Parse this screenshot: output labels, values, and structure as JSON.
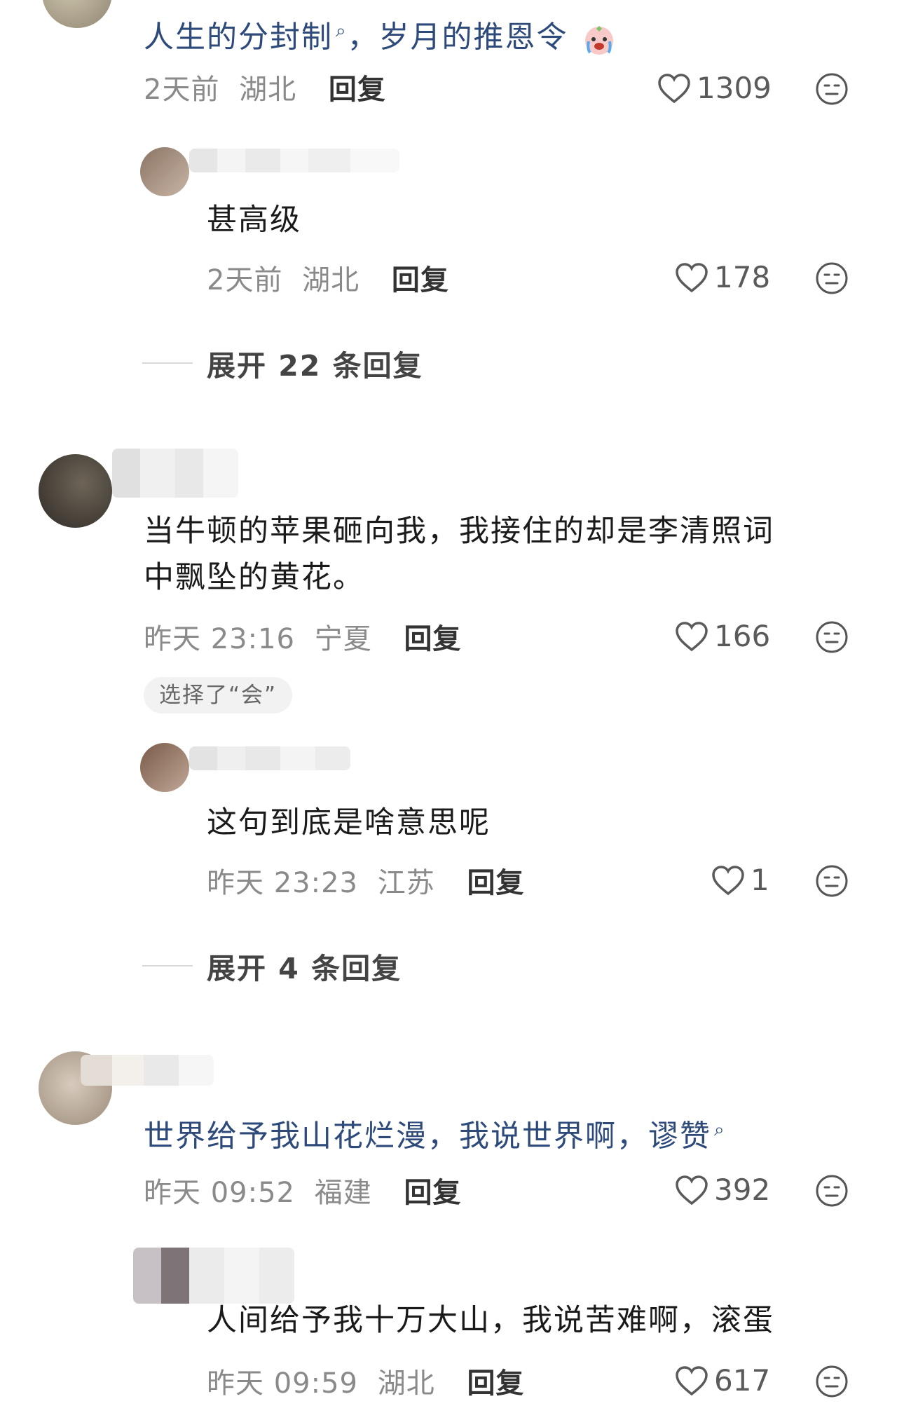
{
  "comments": [
    {
      "text": "人生的分封制",
      "text_tail": "，岁月的推恩令",
      "time": "2天前",
      "location": "湖北",
      "reply": "回复",
      "likes": "1309",
      "replies": [
        {
          "text": "甚高级",
          "time": "2天前",
          "location": "湖北",
          "reply": "回复",
          "likes": "178"
        }
      ],
      "expand": "展开 22 条回复"
    },
    {
      "text_line1": "当牛顿的苹果砸向我，我接住的却是李清照词",
      "text_line2": "中飘坠的黄花。",
      "time": "昨天 23:16",
      "location": "宁夏",
      "reply": "回复",
      "likes": "166",
      "chip": "选择了“会”",
      "replies": [
        {
          "text": "这句到底是啥意思呢",
          "time": "昨天 23:23",
          "location": "江苏",
          "reply": "回复",
          "likes": "1"
        }
      ],
      "expand": "展开 4 条回复"
    },
    {
      "text": "世界给予我山花烂漫，我说世界啊，谬赞",
      "time": "昨天 09:52",
      "location": "福建",
      "reply": "回复",
      "likes": "392",
      "replies": [
        {
          "text": "人间给予我十万大山，我说苦难啊，滚蛋",
          "time": "昨天 09:59",
          "location": "湖北",
          "reply": "回复",
          "likes": "617"
        }
      ]
    }
  ],
  "icons": {
    "like": "heart-outline-icon",
    "dislike": "neutral-face-icon",
    "search": "search-magnifier-icon",
    "emoji": "crying-emoji-icon"
  },
  "colors": {
    "link_text": "#2d4a7a",
    "meta": "#8a8a8a",
    "text": "#1a1a1a"
  }
}
